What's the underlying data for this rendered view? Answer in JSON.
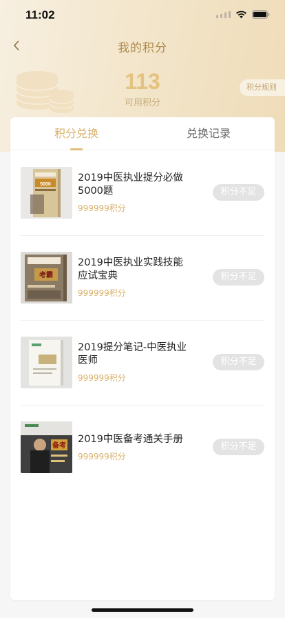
{
  "status_bar": {
    "time": "11:02"
  },
  "nav": {
    "title": "我的积分"
  },
  "summary": {
    "points": "113",
    "points_label": "可用积分",
    "rules_label": "积分规则"
  },
  "tabs": [
    {
      "label": "积分兑换",
      "active": true
    },
    {
      "label": "兑换记录",
      "active": false
    }
  ],
  "items": [
    {
      "title": "2019中医执业提分必做5000题",
      "points": "999999积分",
      "button": "积分不足"
    },
    {
      "title": "2019中医执业实践技能应试宝典",
      "points": "999999积分",
      "button": "积分不足"
    },
    {
      "title": "2019提分笔记-中医执业医师",
      "points": "999999积分",
      "button": "积分不足"
    },
    {
      "title": "2019中医备考通关手册",
      "points": "999999积分",
      "button": "积分不足"
    }
  ],
  "colors": {
    "accent": "#d9b16b",
    "points_value": "#e4c27f",
    "button_disabled": "#e3e3e3"
  },
  "icons": [
    "back-chevron-icon",
    "coin-stack-icon",
    "signal-icon",
    "wifi-icon",
    "battery-icon"
  ]
}
